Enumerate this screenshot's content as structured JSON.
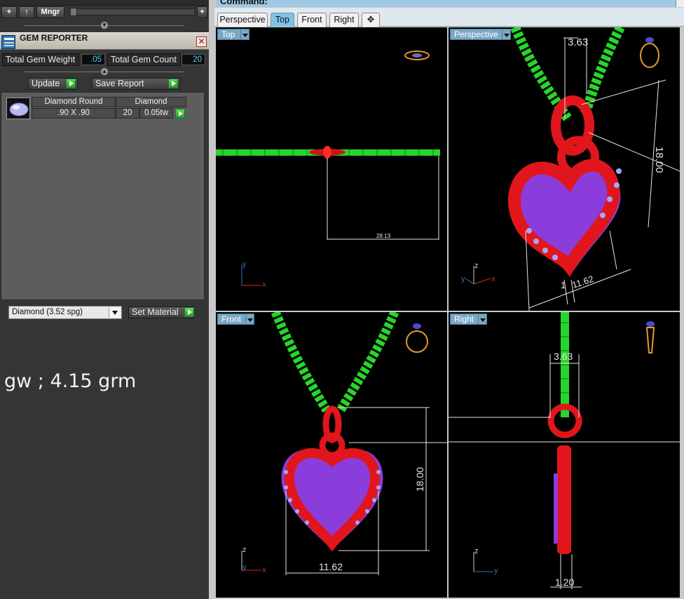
{
  "toolbar": {
    "add_label": "+",
    "up_label": "↑",
    "manager_label": "Mngr",
    "plus_label": "+"
  },
  "gem_reporter": {
    "title": "GEM REPORTER",
    "close_label": "✕",
    "total_weight_label": "Total Gem Weight",
    "total_weight_value": ".05",
    "total_count_label": "Total Gem Count",
    "total_count_value": "20",
    "update_label": "Update",
    "save_report_label": "Save Report",
    "gems": [
      {
        "shape": "Diamond Round",
        "size": ".90 X .90",
        "material": "Diamond",
        "count": "20",
        "weight": "0.05tw"
      }
    ],
    "material_value": "Diamond    (3.52 spg)",
    "set_material_label": "Set Material"
  },
  "note": "gw ; 4.15 grm",
  "command": {
    "label": "Command:"
  },
  "tabs": [
    {
      "label": "Perspective",
      "active": false
    },
    {
      "label": "Top",
      "active": true
    },
    {
      "label": "Front",
      "active": false
    },
    {
      "label": "Right",
      "active": false
    },
    {
      "label": "✥",
      "active": false
    }
  ],
  "viewports": {
    "top": {
      "label": "Top",
      "dimension": "28.13"
    },
    "perspective": {
      "label": "Perspective",
      "dim_width": "3.63",
      "dim_height": "18.00",
      "dim_depth": "1",
      "dim_bottom": "11.62"
    },
    "front": {
      "label": "Front",
      "dim_height": "18.00",
      "dim_width": "11.62"
    },
    "right": {
      "label": "Right",
      "dim_top": "3.63",
      "dim_bottom": "1.20"
    }
  },
  "axes": {
    "x": "x",
    "y": "y",
    "z": "z"
  },
  "colors": {
    "chain": "#27d62a",
    "metal": "#e0161c",
    "gem_strip": "#8a3ddb",
    "dim_line": "#e6e6e6",
    "axis_x": "#c8322a",
    "axis_y": "#3a6fbd",
    "axis_z": "#cfcfcf",
    "viewport_bg": "#000000",
    "label_bg": "#7aa7c6"
  }
}
